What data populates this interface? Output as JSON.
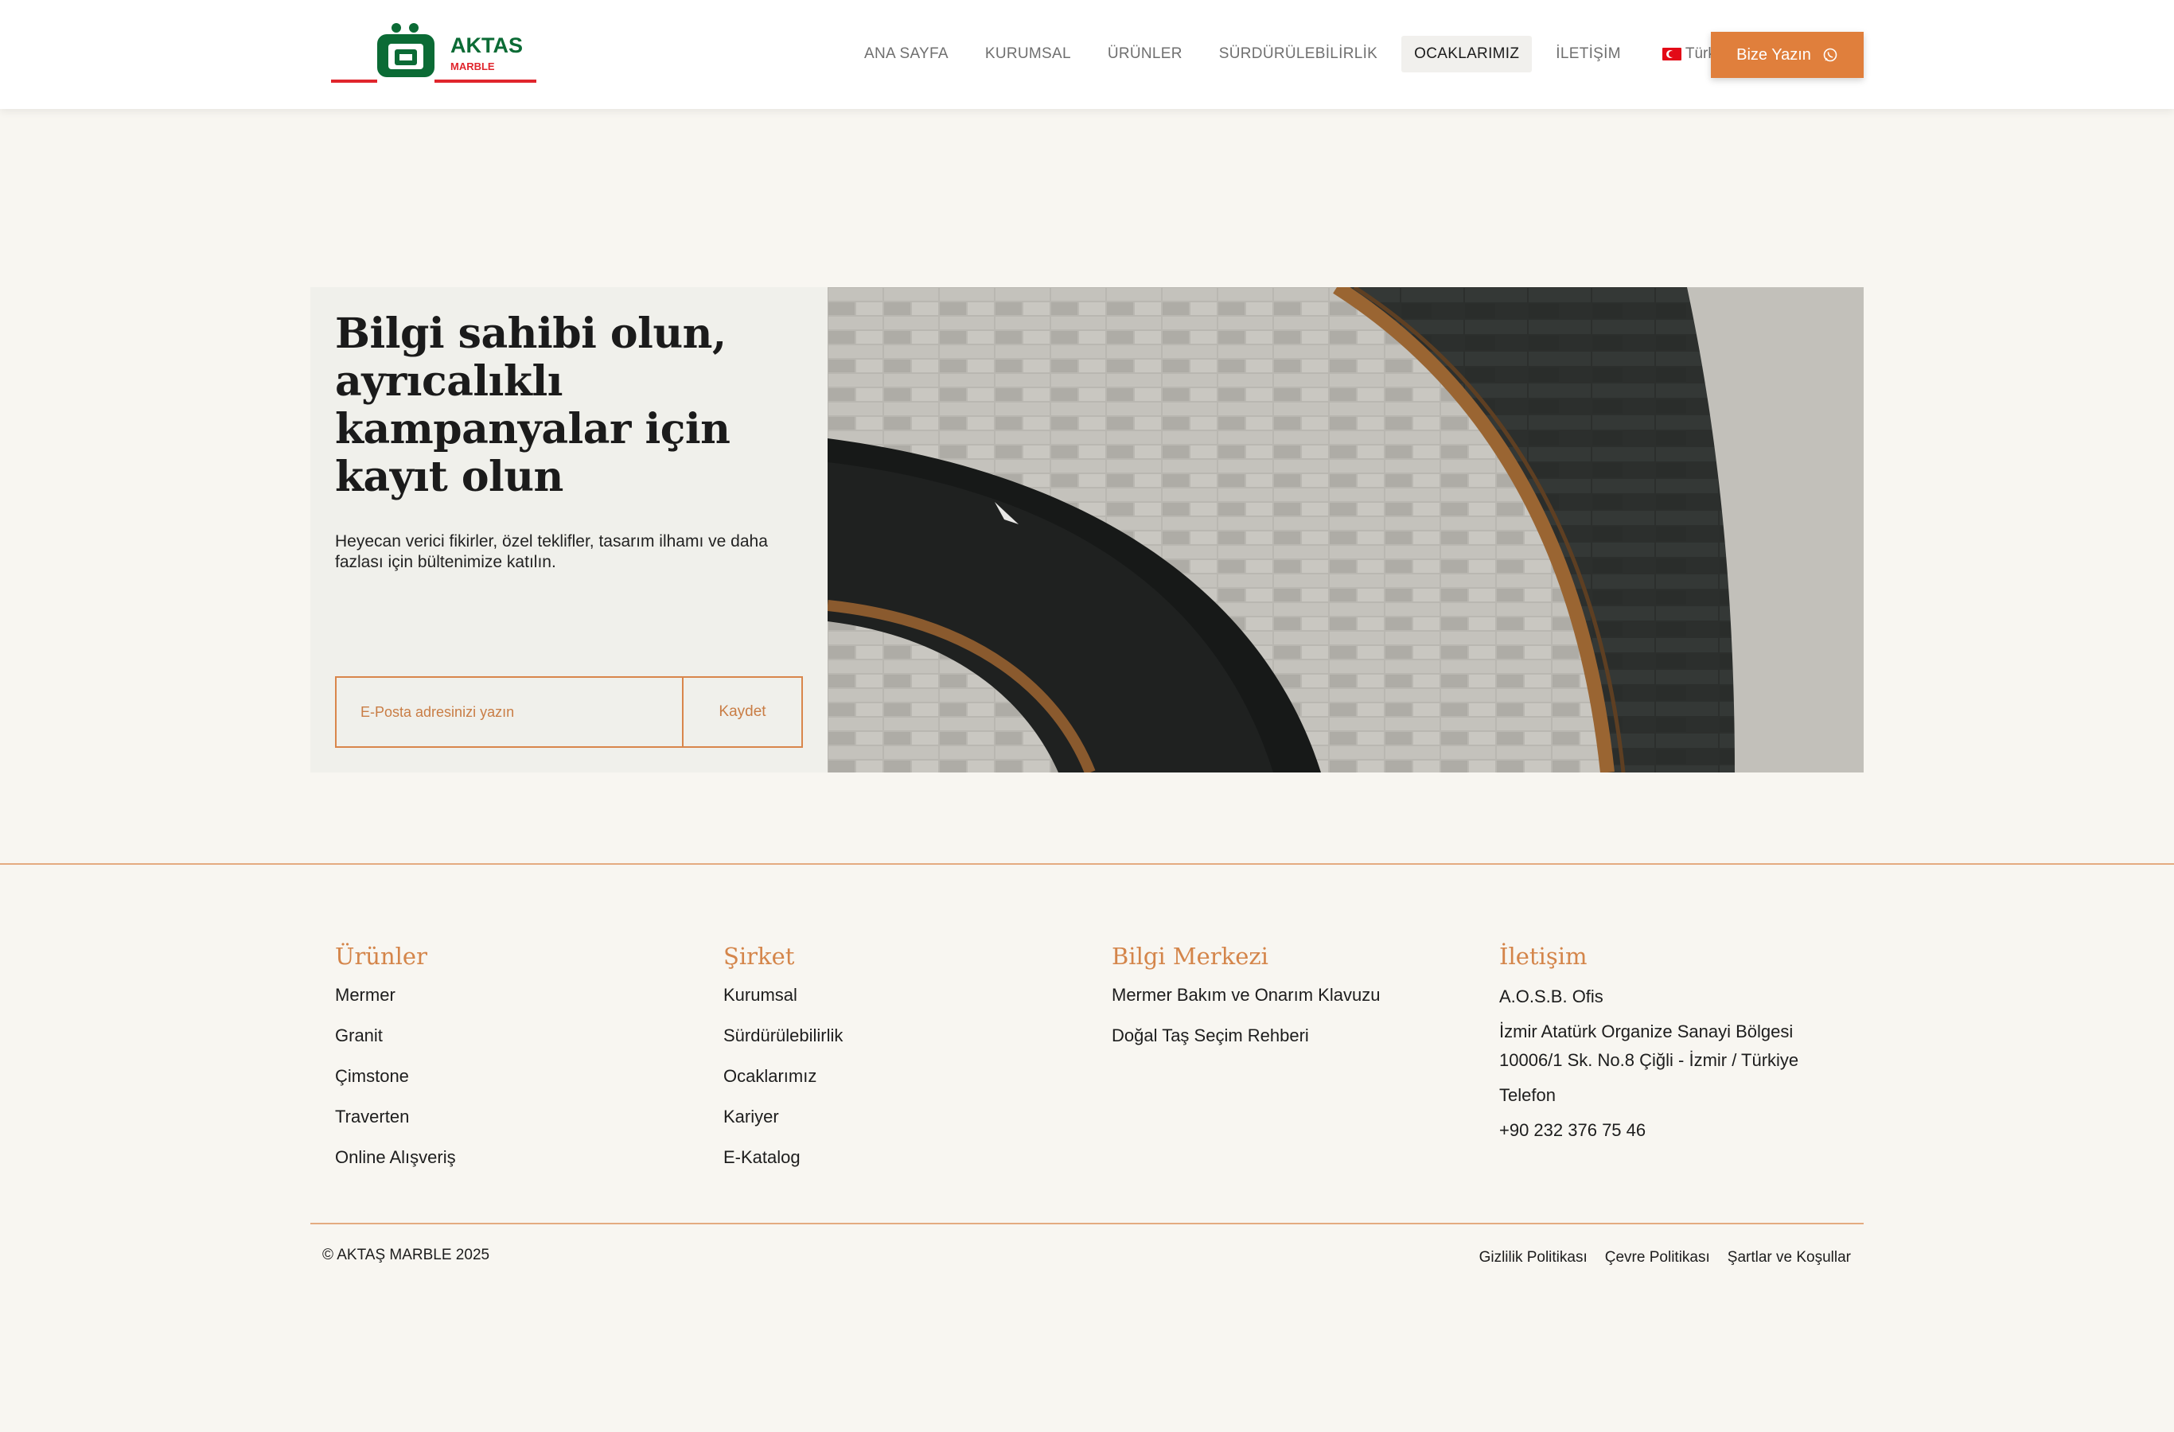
{
  "brand": {
    "name": "AKTAS",
    "sub": "MARBLE",
    "green": "#0b6b35",
    "red": "#e0252c",
    "accent": "#e07f3c"
  },
  "nav": {
    "items": [
      "ANA SAYFA",
      "KURUMSAL",
      "ÜRÜNLER",
      "SÜRDÜRÜLEBİLİRLİK",
      "OCAKLARIMIZ",
      "İLETİŞİM"
    ],
    "active": "OCAKLARIMIZ",
    "language": "Türkçe",
    "language_icon": "turkey-flag-icon",
    "cta_label": "Bize Yazın",
    "cta_icon": "whatsapp-icon"
  },
  "newsletter": {
    "title": "Bilgi sahibi olun, ayrıcalıklı kampanyalar için kayıt olun",
    "description": "Heyecan verici fikirler, özel teklifler, tasarım ilhamı ve daha fazlası için bültenimize katılın.",
    "email_placeholder": "E-Posta adresinizi yazın",
    "email_value": "",
    "submit_label": "Kaydet"
  },
  "footer": {
    "columns": [
      {
        "title": "Ürünler",
        "links": [
          "Mermer",
          "Granit",
          "Çimstone",
          "Traverten",
          "Online Alışveriş"
        ]
      },
      {
        "title": "Şirket",
        "links": [
          "Kurumsal",
          "Sürdürülebilirlik",
          "Ocaklarımız",
          "Kariyer",
          "E-Katalog"
        ]
      },
      {
        "title": "Bilgi Merkezi",
        "links": [
          "Mermer Bakım ve Onarım Klavuzu",
          "Doğal Taş Seçim Rehberi"
        ]
      }
    ],
    "contact": {
      "title": "İletişim",
      "office": "A.O.S.B. Ofis",
      "address_line1": "İzmir Atatürk Organize Sanayi Bölgesi",
      "address_line2": "10006/1 Sk. No.8 Çiğli - İzmir / Türkiye",
      "phone_label": "Telefon",
      "phone": "+90 232 376 75 46"
    },
    "copyright": "© AKTAŞ MARBLE 2025",
    "legal": [
      "Gizlilik Politikası",
      "Çevre Politikası",
      "Şartlar ve Koşullar"
    ]
  }
}
